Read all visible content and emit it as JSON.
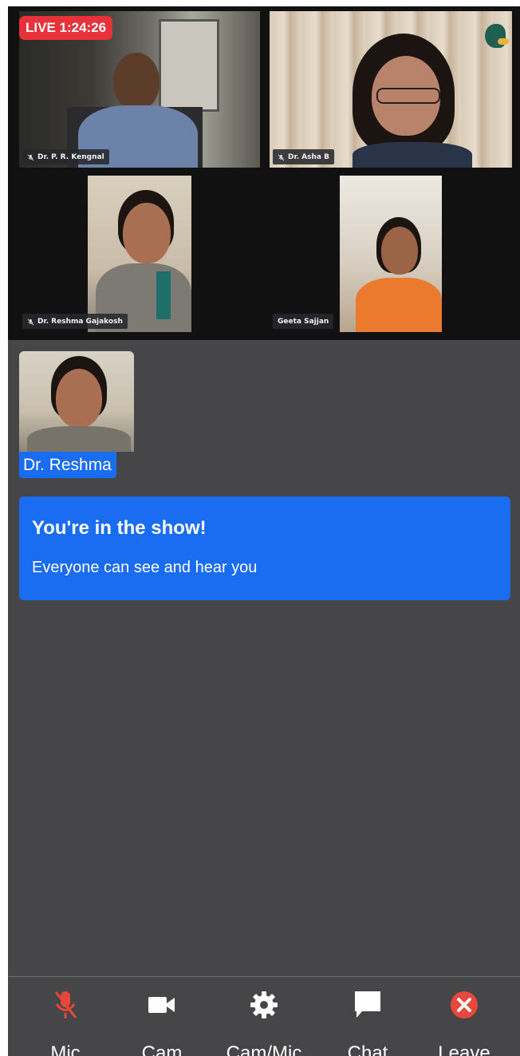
{
  "live": {
    "label": "LIVE 1:24:26"
  },
  "participants": [
    {
      "name": "Dr. P. R. Kengnal",
      "muted": true
    },
    {
      "name": "Dr. Asha B",
      "muted": true
    },
    {
      "name": "Dr. Reshma Gajakosh",
      "muted": true
    },
    {
      "name": "Geeta Sajjan",
      "muted": false
    }
  ],
  "self": {
    "name": "Dr. Reshma"
  },
  "toast": {
    "title": "You're in the show!",
    "message": "Everyone can see and hear you"
  },
  "controls": {
    "mic": {
      "label": "Mic",
      "icon": "mic-off-icon",
      "color": "#e8473b"
    },
    "cam": {
      "label": "Cam",
      "icon": "video-camera-icon"
    },
    "settings": {
      "label": "Cam/Mic",
      "icon": "gear-icon"
    },
    "chat": {
      "label": "Chat",
      "icon": "chat-bubble-icon"
    },
    "leave": {
      "label": "Leave",
      "icon": "close-circle-icon",
      "color": "#e8473b"
    }
  },
  "colors": {
    "accent": "#1a6cf0",
    "live": "#e8323a",
    "background": "#464648",
    "stage": "#111111"
  }
}
